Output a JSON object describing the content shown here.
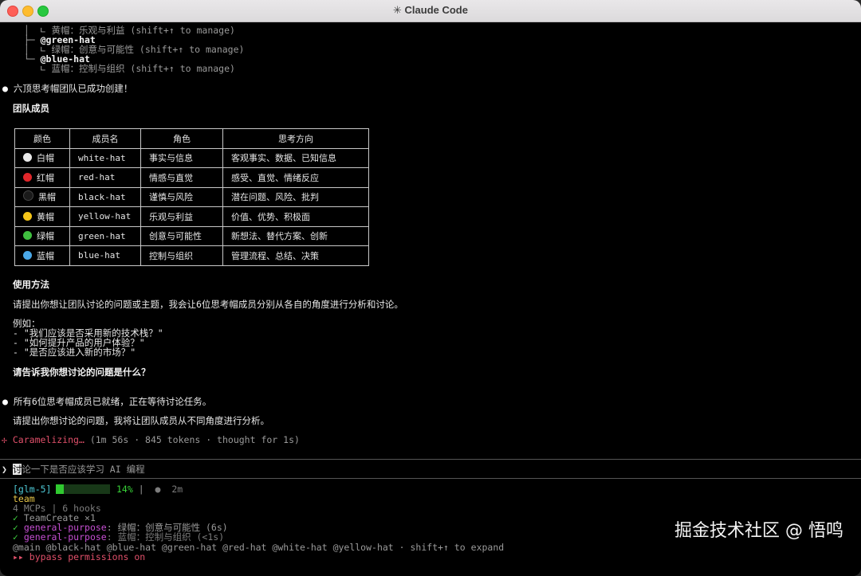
{
  "window": {
    "title": "✳ Claude Code"
  },
  "tree": [
    {
      "prefix": "  │  ∟ ",
      "text": "黄帽：乐观与利益 (shift+↑ to manage)"
    },
    {
      "prefix": "  ├─ ",
      "text": "@green-hat"
    },
    {
      "prefix": "  │  ∟ ",
      "text": "绿帽：创意与可能性 (shift+↑ to manage)"
    },
    {
      "prefix": "  └─ ",
      "text": "@blue-hat"
    },
    {
      "prefix": "     ∟ ",
      "text": "蓝帽：控制与组织 (shift+↑ to manage)"
    }
  ],
  "msg1": {
    "bullet": "●",
    "text": "六顶思考帽团队已成功创建！"
  },
  "team_heading": "团队成员",
  "table": {
    "headers": [
      "颜色",
      "成员名",
      "角色",
      "思考方向"
    ],
    "rows": [
      {
        "color_label": "白帽",
        "dot": "#e8e8e8",
        "name": "white-hat",
        "role": "事实与信息",
        "direction": "客观事实、数据、已知信息"
      },
      {
        "color_label": "红帽",
        "dot": "#e0262a",
        "name": "red-hat",
        "role": "情感与直觉",
        "direction": "感受、直觉、情绪反应"
      },
      {
        "color_label": "黑帽",
        "dot": "#1a1a1a",
        "name": "black-hat",
        "role": "谨慎与风险",
        "direction": "潜在问题、风险、批判"
      },
      {
        "color_label": "黄帽",
        "dot": "#f5c518",
        "name": "yellow-hat",
        "role": "乐观与利益",
        "direction": "价值、优势、积极面"
      },
      {
        "color_label": "绿帽",
        "dot": "#3fbf3f",
        "name": "green-hat",
        "role": "创意与可能性",
        "direction": "新想法、替代方案、创新"
      },
      {
        "color_label": "蓝帽",
        "dot": "#4aa8e8",
        "name": "blue-hat",
        "role": "控制与组织",
        "direction": "管理流程、总结、决策"
      }
    ]
  },
  "usage_heading": "使用方法",
  "usage_text": "请提出你想让团队讨论的问题或主题，我会让6位思考帽成员分别从各自的角度进行分析和讨论。",
  "example_label": "例如：",
  "examples": [
    "- \"我们应该是否采用新的技术栈？\"",
    "- \"如何提升产品的用户体验？\"",
    "- \"是否应该进入新的市场？\""
  ],
  "ask": "请告诉我你想讨论的问题是什么？",
  "msg2": {
    "bullet": "●",
    "text": "所有6位思考帽成员已就绪，正在等待讨论任务。"
  },
  "msg2_sub": "请提出你想讨论的问题，我将让团队成员从不同角度进行分析。",
  "status": {
    "glyph": "✢",
    "verb": "Caramelizing…",
    "detail": " (1m 56s · 845 tokens · thought for 1s)"
  },
  "prompt": {
    "symbol": "❯",
    "cursor_char": "讨",
    "rest": "论一下是否应该学习 AI 编程"
  },
  "statusline": {
    "model": "[glm-5]",
    "percent_value": 14,
    "percent_label": "14%",
    "pipe": "|",
    "dot": "●",
    "time": "2m",
    "team": "team",
    "mcps": "4 MCPs | 6 hooks",
    "tool_line": {
      "check": "✓",
      "text": "TeamCreate ×1"
    },
    "agents": [
      {
        "check": "✓",
        "type": "general-purpose",
        "desc": ": 绿帽：创意与可能性 (6s)"
      },
      {
        "check": "✓",
        "type": "general-purpose",
        "desc": ": 蓝帽：控制与组织 (<1s)"
      }
    ],
    "members": "@main @black-hat @blue-hat @green-hat @red-hat @white-hat @yellow-hat · shift+↑ to expand",
    "mode": {
      "glyph": "▸▸",
      "text": "bypass permissions on"
    }
  },
  "watermark": "掘金技术社区 @ 悟鸣"
}
